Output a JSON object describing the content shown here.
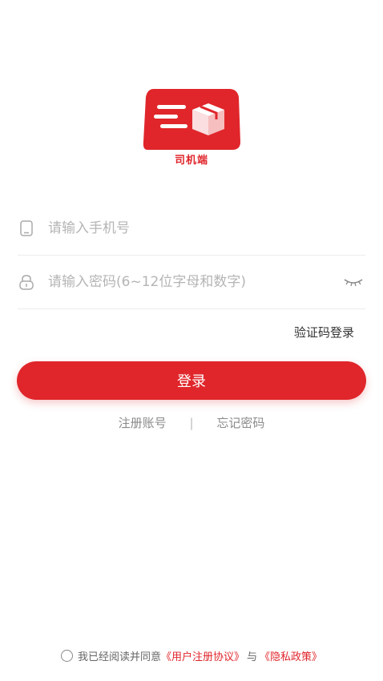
{
  "logo": {
    "caption": "司机端",
    "icon": "truck-box-logo"
  },
  "phone_field": {
    "placeholder": "请输入手机号",
    "icon": "phone-icon"
  },
  "password_field": {
    "placeholder": "请输入密码(6~12位字母和数字)",
    "icon": "lock-icon",
    "toggle_icon": "eye-closed-icon"
  },
  "code_login": "验证码登录",
  "login_button": "登录",
  "links": {
    "register": "注册账号",
    "separator": "|",
    "forgot": "忘记密码"
  },
  "agreement": {
    "prefix": "我已经阅读并同意",
    "user_agreement": "《用户注册协议》",
    "connector": "与",
    "privacy_policy": "《隐私政策》"
  },
  "colors": {
    "accent": "#e0262b"
  }
}
